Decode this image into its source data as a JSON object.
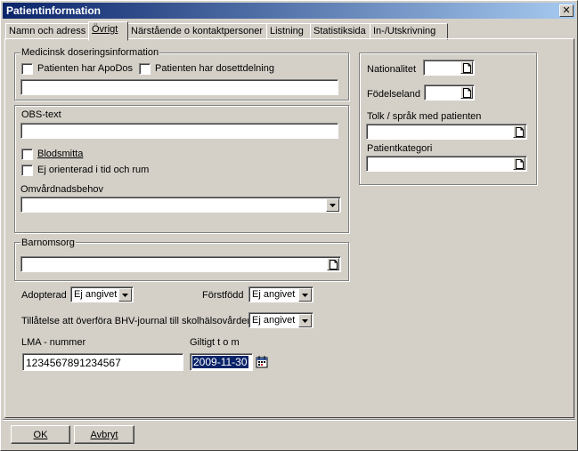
{
  "window": {
    "title": "Patientinformation",
    "close_glyph": "✕"
  },
  "tabs": [
    {
      "label": "Namn och adress"
    },
    {
      "label": "Övrigt"
    },
    {
      "label": "Närstående o kontaktpersoner"
    },
    {
      "label": "Listning"
    },
    {
      "label": "Statistiksida"
    },
    {
      "label": "In-/Utskrivning"
    }
  ],
  "dosering": {
    "group_label": "Medicinsk doseringsinformation",
    "apodos_label": "Patienten har ApoDos",
    "dosett_label": "Patienten har dosettdelning",
    "text_value": ""
  },
  "obs": {
    "group_label": "OBS-text",
    "text_value": "",
    "blodsmitta_label": "Blodsmitta",
    "ej_orienterad_label": "Ej orienterad i tid och rum",
    "omvardnad_label": "Omvårdnadsbehov",
    "omvardnad_value": ""
  },
  "barnomsorg": {
    "group_label": "Barnomsorg",
    "value": ""
  },
  "right_group": {
    "nationalitet_label": "Nationalitet",
    "fodelseland_label": "Födelseland",
    "tolk_label": "Tolk / språk med patienten",
    "patientkategori_label": "Patientkategori"
  },
  "adopterad": {
    "label": "Adopterad",
    "value": "Ej angivet"
  },
  "forstfodd": {
    "label": "Förstfödd",
    "value": "Ej angivet"
  },
  "bhv": {
    "label": "Tillåtelse att överföra BHV-journal till skolhälsovården",
    "value": "Ej angivet"
  },
  "lma": {
    "label": "LMA - nummer",
    "value": "1234567891234567"
  },
  "giltigt": {
    "label": "Giltigt t o m",
    "value": "2009-11-30"
  },
  "buttons": {
    "ok": "OK",
    "avbryt": "Avbryt"
  },
  "icons": [
    "close-icon",
    "document-icon",
    "dropdown-arrow-icon",
    "calendar-icon"
  ]
}
